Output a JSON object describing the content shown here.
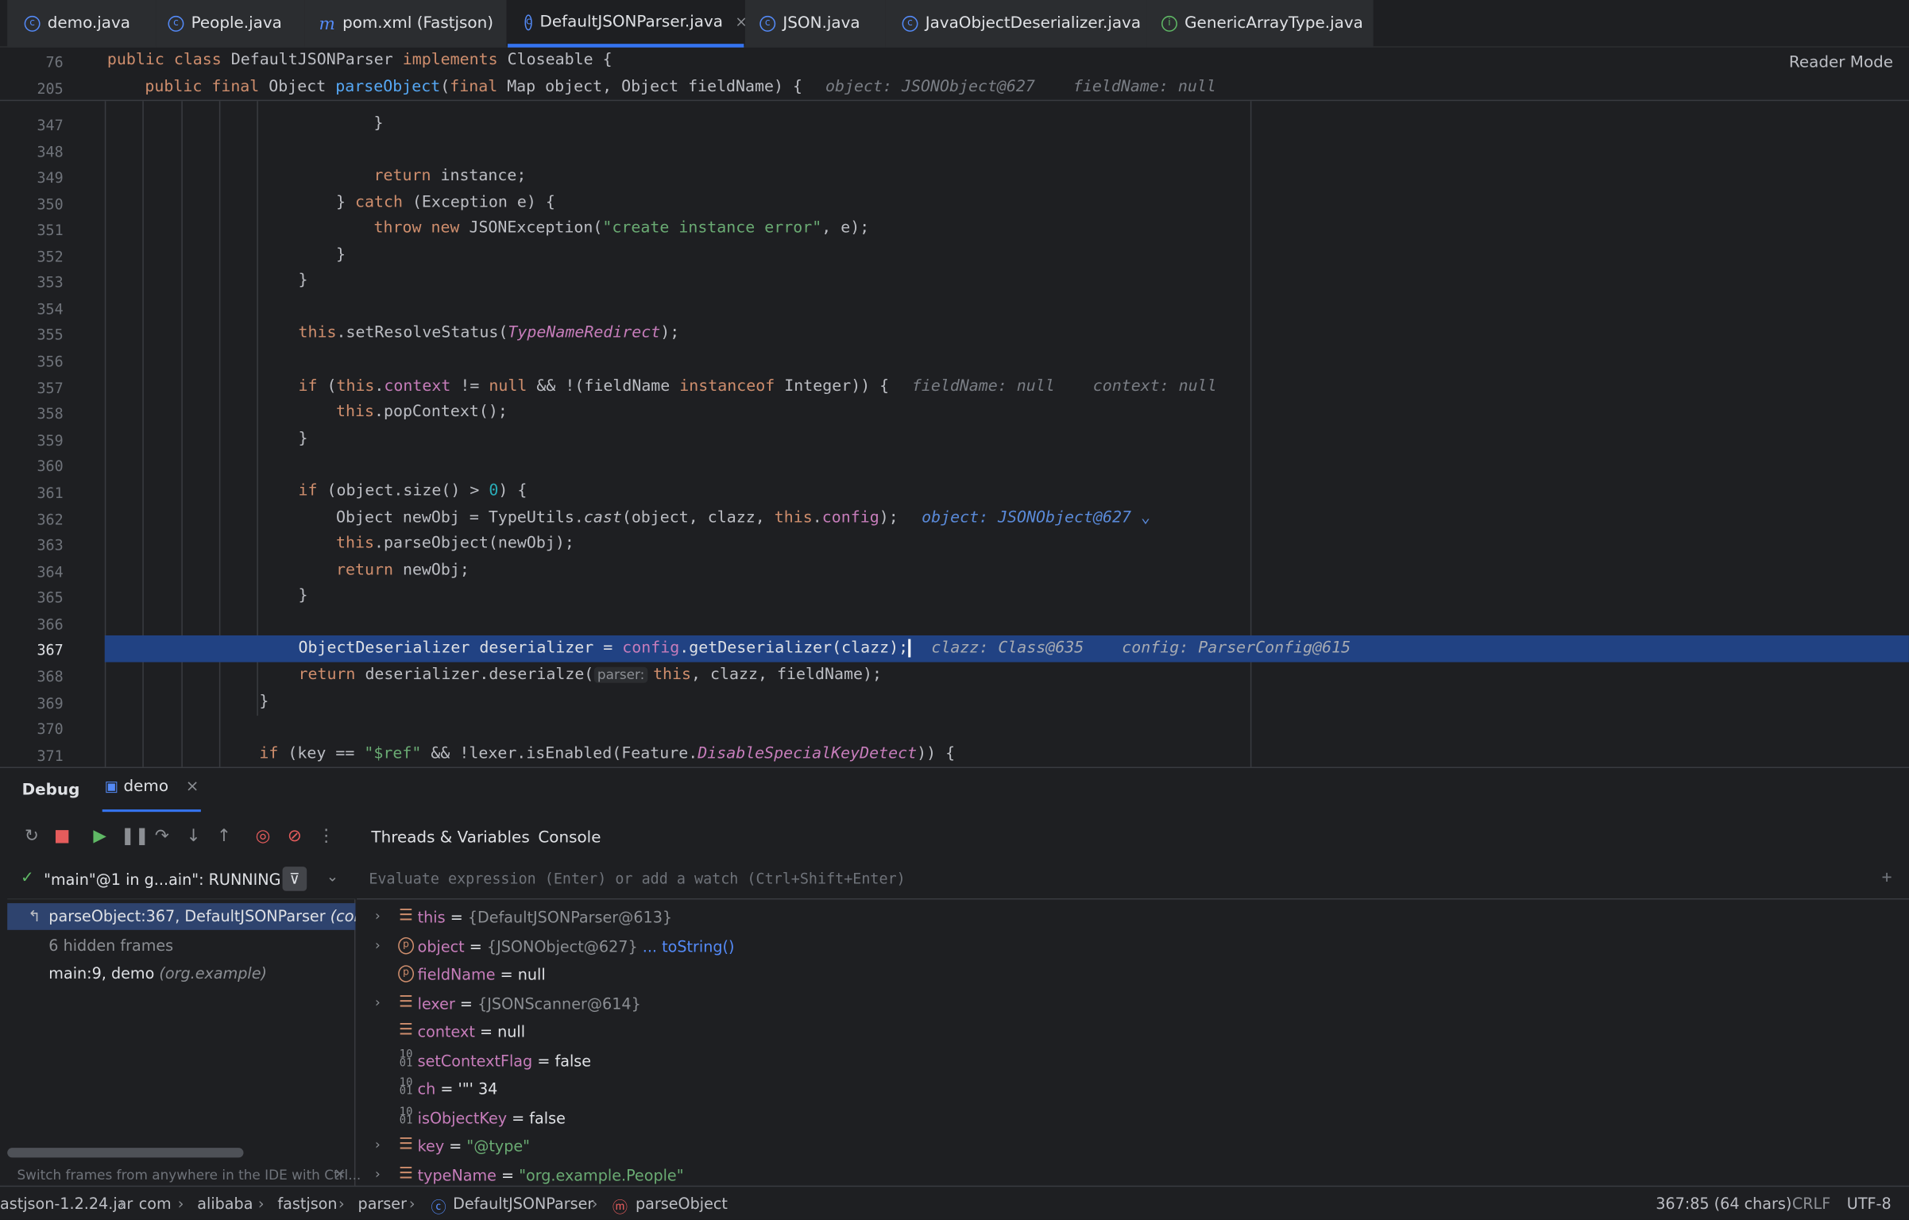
{
  "tabs": [
    {
      "label": "demo.java",
      "icon": "class-icon"
    },
    {
      "label": "People.java",
      "icon": "class-icon"
    },
    {
      "label": "pom.xml (Fastjson)",
      "icon": "maven-icon"
    },
    {
      "label": "DefaultJSONParser.java",
      "icon": "class-icon",
      "active": true,
      "close": "×"
    },
    {
      "label": "JSON.java",
      "icon": "class-icon"
    },
    {
      "label": "JavaObjectDeserializer.java",
      "icon": "class-icon"
    },
    {
      "label": "GenericArrayType.java",
      "icon": "interface-icon"
    }
  ],
  "editor": {
    "reader_mode": "Reader Mode",
    "sticky": [
      {
        "ln": "76",
        "code": "public class DefaultJSONParser implements Closeable {"
      },
      {
        "ln": "205",
        "code": "public final Object parseObject(final Map object, Object fieldName) {",
        "hint": "object: JSONObject@627    fieldName: null"
      }
    ],
    "lines": [
      {
        "ln": "347",
        "code": "}"
      },
      {
        "ln": "348",
        "code": ""
      },
      {
        "ln": "349",
        "code": "return instance;"
      },
      {
        "ln": "350",
        "code": "} catch (Exception e) {"
      },
      {
        "ln": "351",
        "code": "throw new JSONException(\"create instance error\", e);"
      },
      {
        "ln": "352",
        "code": "}"
      },
      {
        "ln": "353",
        "code": "}"
      },
      {
        "ln": "354",
        "code": ""
      },
      {
        "ln": "355",
        "code": "this.setResolveStatus(TypeNameRedirect);"
      },
      {
        "ln": "356",
        "code": ""
      },
      {
        "ln": "357",
        "code": "if (this.context != null && !(fieldName instanceof Integer)) {",
        "hint": "fieldName: null    context: null"
      },
      {
        "ln": "358",
        "code": "this.popContext();"
      },
      {
        "ln": "359",
        "code": "}"
      },
      {
        "ln": "360",
        "code": ""
      },
      {
        "ln": "361",
        "code": "if (object.size() > 0) {"
      },
      {
        "ln": "362",
        "code": "Object newObj = TypeUtils.cast(object, clazz, this.config);",
        "hint": "object: JSONObject@627"
      },
      {
        "ln": "363",
        "code": "this.parseObject(newObj);"
      },
      {
        "ln": "364",
        "code": "return newObj;"
      },
      {
        "ln": "365",
        "code": "}"
      },
      {
        "ln": "366",
        "code": ""
      },
      {
        "ln": "367",
        "code": "ObjectDeserializer deserializer = config.getDeserializer(clazz);",
        "hint": "clazz: Class@635    config: ParserConfig@615"
      },
      {
        "ln": "368",
        "code": "return deserializer.deserialze(",
        "inlay": "parser:",
        "code2": "this, clazz, fieldName);"
      },
      {
        "ln": "369",
        "code": "}"
      },
      {
        "ln": "370",
        "code": ""
      },
      {
        "ln": "371",
        "code": "if (key == \"$ref\" && !lexer.isEnabled(Feature.DisableSpecialKeyDetect)) {"
      }
    ]
  },
  "debug": {
    "title": "Debug",
    "session": "demo",
    "session_close": "×",
    "subtabs": [
      "Threads & Variables",
      "Console"
    ],
    "thread": "\"main\"@1 in g...ain\": RUNNING",
    "frames": [
      {
        "label": "parseObject:367, DefaultJSONParser",
        "pkg": "(com.al",
        "selected": true
      },
      {
        "label": "6 hidden frames",
        "pkg": ""
      },
      {
        "label": "main:9, demo",
        "pkg": "(org.example)"
      }
    ],
    "frames_hint": "Switch frames from anywhere in the IDE with Ctrl...",
    "eval_placeholder": "Evaluate expression (Enter) or add a watch (Ctrl+Shift+Enter)",
    "variables": [
      {
        "name": "this",
        "value": "{DefaultJSONParser@613}",
        "kind": "field",
        "expandable": true
      },
      {
        "name": "object",
        "value": "{JSONObject@627}",
        "link": "... toString()",
        "kind": "param",
        "expandable": true
      },
      {
        "name": "fieldName",
        "value": "null",
        "kind": "param",
        "expandable": false
      },
      {
        "name": "lexer",
        "value": "{JSONScanner@614}",
        "kind": "field",
        "expandable": true
      },
      {
        "name": "context",
        "value": "null",
        "kind": "field",
        "expandable": false
      },
      {
        "name": "setContextFlag",
        "value": "false",
        "kind": "prim",
        "expandable": false
      },
      {
        "name": "ch",
        "value": "'\"' 34",
        "kind": "prim",
        "expandable": false
      },
      {
        "name": "isObjectKey",
        "value": "false",
        "kind": "prim",
        "expandable": false
      },
      {
        "name": "key",
        "value": "\"@type\"",
        "kind": "field",
        "expandable": true,
        "string": true
      },
      {
        "name": "typeName",
        "value": "\"org.example.People\"",
        "kind": "field",
        "expandable": true,
        "string": true
      }
    ]
  },
  "statusbar": {
    "crumbs": [
      "astjson-1.2.24.jar",
      "com",
      "alibaba",
      "fastjson",
      "parser",
      "DefaultJSONParser",
      "parseObject"
    ],
    "position": "367:85 (64 chars)",
    "line_sep": "CRLF",
    "encoding": "UTF-8"
  },
  "colors": {
    "accent": "#3574f0",
    "highlight": "#214283",
    "keyword": "#cf8e6d",
    "string": "#6aab73",
    "method": "#56a8f5"
  }
}
